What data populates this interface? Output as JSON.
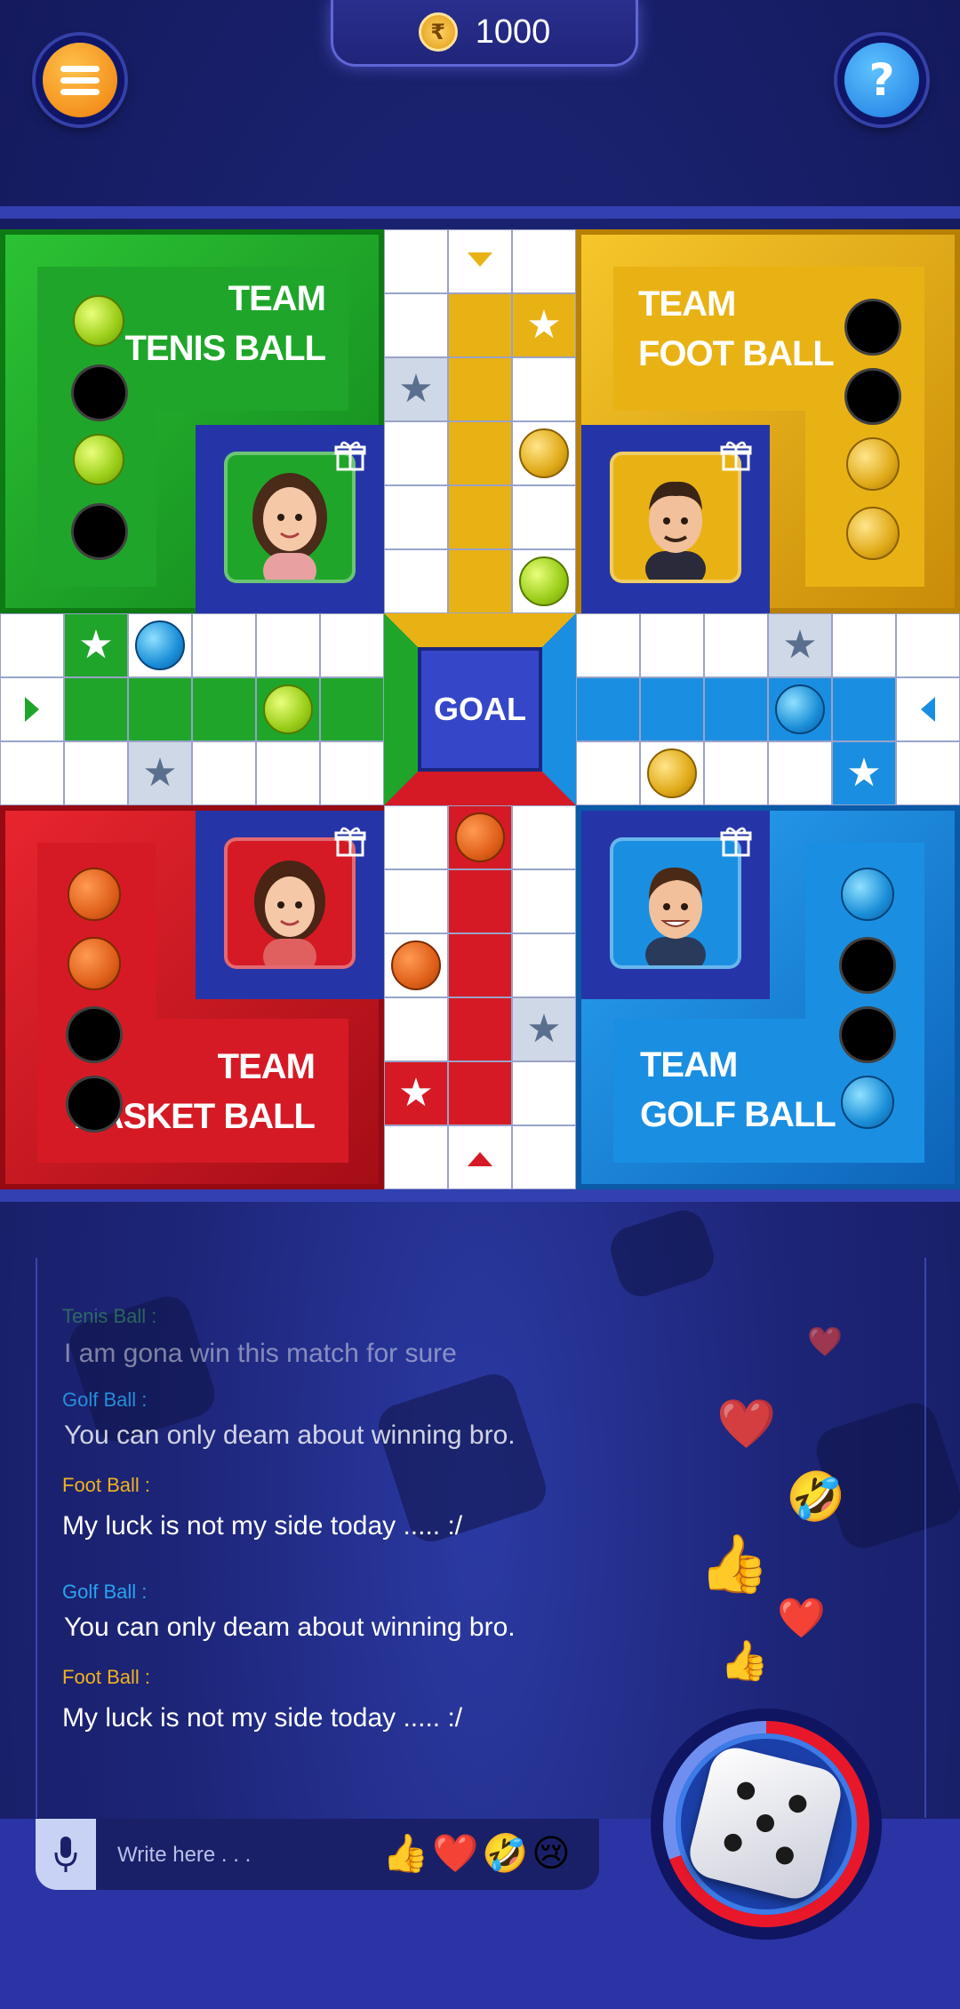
{
  "header": {
    "coin_symbol": "₹",
    "coin_balance": "1000",
    "menu_icon": "list-icon",
    "help_label": "?"
  },
  "board": {
    "goal_label": "GOAL",
    "teams": {
      "green": {
        "line1": "TEAM",
        "line2": "TENIS BALL",
        "color": "#1fa62a"
      },
      "yellow": {
        "line1": "TEAM",
        "line2": "FOOT BALL",
        "color": "#e9b214"
      },
      "red": {
        "line1": "TEAM",
        "line2": "BASKET BALL",
        "color": "#d51a25"
      },
      "blue": {
        "line1": "TEAM",
        "line2": "GOLF BALL",
        "color": "#1a8fe2"
      }
    }
  },
  "chat": {
    "messages": [
      {
        "name": "Tenis Ball :",
        "text": "I am gona win this match for sure",
        "color": "#3fa35a"
      },
      {
        "name": "Golf Ball :",
        "text": "You can only deam about winning bro.",
        "color": "#2aa3f0"
      },
      {
        "name": "Foot Ball :",
        "text": "My luck is not my side today ..... :/",
        "color": "#f2b21c"
      },
      {
        "name": "Golf Ball :",
        "text": "You can only deam about winning bro.",
        "color": "#2aa3f0"
      },
      {
        "name": "Foot Ball :",
        "text": "My luck is not my side today ..... :/",
        "color": "#f2b21c"
      }
    ],
    "input_placeholder": "Write here . . .",
    "quick_emojis": [
      "👍",
      "❤️",
      "🤣",
      "😢"
    ],
    "floating_emojis": [
      "❤️",
      "❤️",
      "🤣",
      "👍",
      "❤️",
      "👍"
    ]
  },
  "dice": {
    "face_value": 5
  }
}
